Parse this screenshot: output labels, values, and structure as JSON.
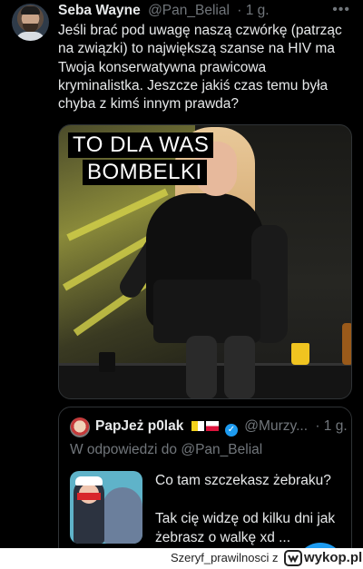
{
  "tweet": {
    "author_name": "Seba Wayne",
    "handle": "@Pan_Belial",
    "dot": "·",
    "time": "1 g.",
    "more_icon": "more-options-icon",
    "text": "Jeśli brać pod uwagę naszą czwórkę (patrząc na związki) to największą szanse na HIV ma Twoja konserwatywna prawicowa kryminalistka. Jeszcze jakiś czas temu była chyba z kimś innym prawda?"
  },
  "media": {
    "caption_line1": "TO DLA WAS",
    "caption_line2": "BOMBELKI"
  },
  "quote": {
    "author_name": "PapJeż p0lak",
    "handle": "@Murzy...",
    "dot": "·",
    "time": "1 g.",
    "verified_icon": "verified-badge-icon",
    "reply_prefix": "W odpowiedzi do",
    "reply_mention": "@Pan_Belial",
    "text_line1": "Co tam szczekasz żebraku?",
    "text_line2": "Tak cię widzę od kilku dni jak żebrasz o walkę xd ..."
  },
  "watermark": {
    "user": "Szeryf_prawilnosci",
    "connector": "z",
    "site": "wykop.pl"
  },
  "colors": {
    "background": "#000000",
    "text": "#e7e9ea",
    "secondary": "#71767b",
    "accent": "#1d9bf0",
    "border": "#2f3336"
  }
}
